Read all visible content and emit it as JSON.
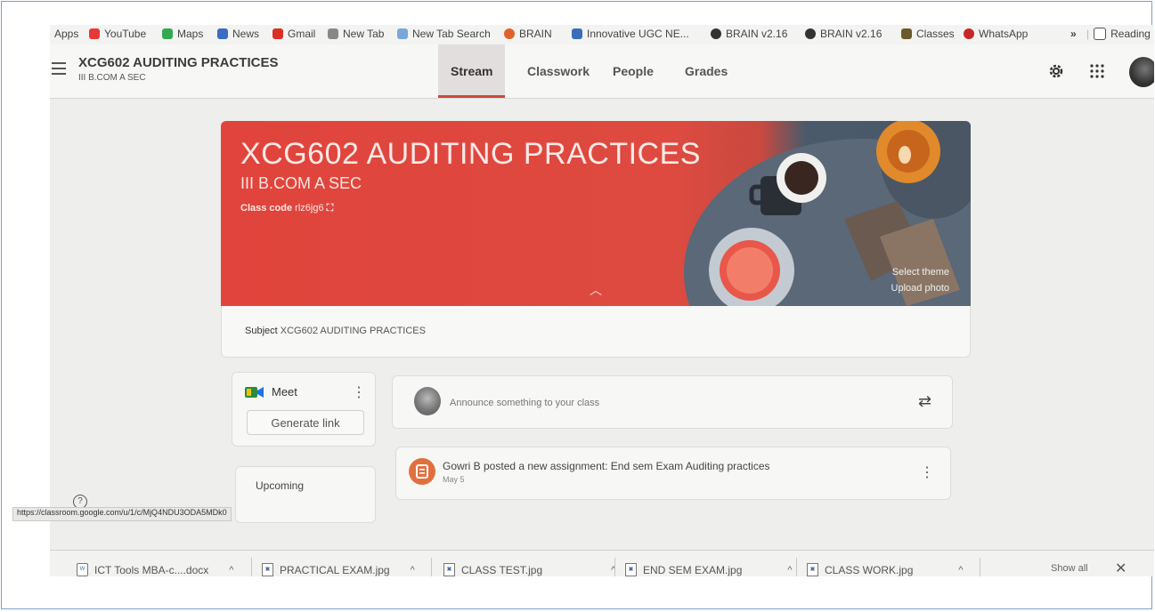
{
  "bookmarks": [
    {
      "label": "Apps",
      "color": "#4a90d9"
    },
    {
      "label": "YouTube",
      "color": "#e53935"
    },
    {
      "label": "Maps",
      "color": "#34a853"
    },
    {
      "label": "News",
      "color": "#3b6cc4"
    },
    {
      "label": "Gmail",
      "color": "#d93025"
    },
    {
      "label": "New Tab",
      "color": "#888888"
    },
    {
      "label": "New Tab Search",
      "color": "#7aa7d9"
    },
    {
      "label": "BRAIN",
      "color": "#e0622a"
    },
    {
      "label": "Innovative UGC NE...",
      "color": "#3a6fb7"
    },
    {
      "label": "BRAIN v2.16",
      "color": "#333333"
    },
    {
      "label": "BRAIN v2.16",
      "color": "#333333"
    },
    {
      "label": "Classes",
      "color": "#6b5a2a"
    },
    {
      "label": "WhatsApp",
      "color": "#c62828"
    }
  ],
  "bookmarks_overflow": "»",
  "reading_list": "Reading",
  "header": {
    "course_title": "XCG602 AUDITING PRACTICES",
    "course_section": "III B.COM A SEC",
    "tabs": [
      "Stream",
      "Classwork",
      "People",
      "Grades"
    ],
    "active_tab": "Stream"
  },
  "banner": {
    "title": "XCG602 AUDITING PRACTICES",
    "section": "III B.COM A SEC",
    "class_code_label": "Class code",
    "class_code": "rlz6jg6",
    "select_theme": "Select theme",
    "upload_photo": "Upload photo"
  },
  "subject": {
    "label": "Subject",
    "value": "XCG602 AUDITING PRACTICES"
  },
  "meet": {
    "label": "Meet",
    "button": "Generate link"
  },
  "upcoming": {
    "label": "Upcoming"
  },
  "announce": {
    "placeholder": "Announce something to your class"
  },
  "post": {
    "title": "Gowri B posted a new assignment: End sem Exam Auditing practices",
    "date": "May 5"
  },
  "status_url": "https://classroom.google.com/u/1/c/MjQ4NDU3ODA5MDk0",
  "downloads": [
    {
      "name": "ICT Tools MBA-c....docx"
    },
    {
      "name": "PRACTICAL EXAM.jpg"
    },
    {
      "name": "CLASS TEST.jpg"
    },
    {
      "name": "END SEM EXAM.jpg"
    },
    {
      "name": "CLASS WORK.jpg"
    }
  ],
  "show_all": "Show all",
  "colors": {
    "banner_red": "#e0443c",
    "accent": "#c94a3c"
  }
}
